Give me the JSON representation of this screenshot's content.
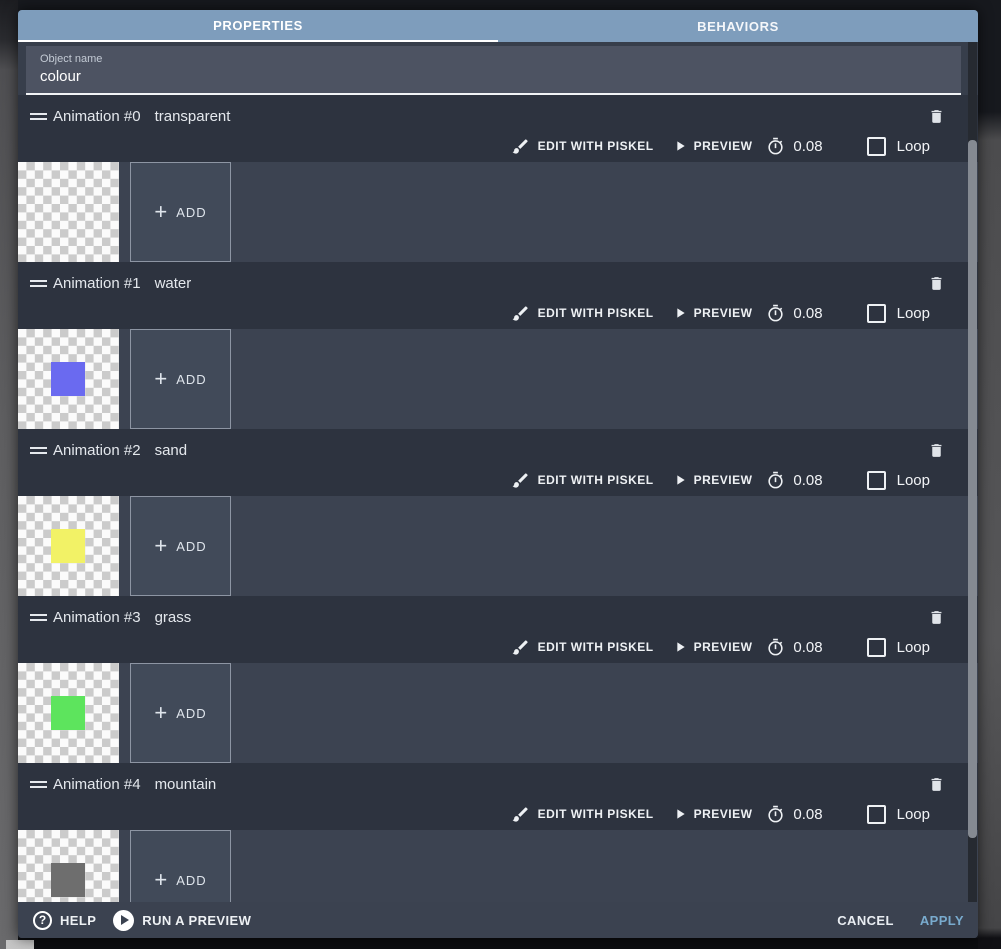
{
  "tabs": {
    "properties": "PROPERTIES",
    "behaviors": "BEHAVIORS"
  },
  "object_name_field": {
    "label": "Object name",
    "value": "colour"
  },
  "animations": [
    {
      "title": "Animation #0",
      "name": "transparent",
      "frame_color": null
    },
    {
      "title": "Animation #1",
      "name": "water",
      "frame_color": "#6a6af0"
    },
    {
      "title": "Animation #2",
      "name": "sand",
      "frame_color": "#f2f266"
    },
    {
      "title": "Animation #3",
      "name": "grass",
      "frame_color": "#5de45d"
    },
    {
      "title": "Animation #4",
      "name": "mountain",
      "frame_color": "#6e6e6e"
    }
  ],
  "controls": {
    "edit": "EDIT WITH PISKEL",
    "preview": "PREVIEW",
    "time_between_frames": "0.08",
    "loop": "Loop",
    "add_plus": "+",
    "add": "ADD"
  },
  "footer": {
    "help": "HELP",
    "run_preview": "RUN A PREVIEW",
    "cancel": "CANCEL",
    "apply": "APPLY"
  },
  "icons": {
    "help_glyph": "?"
  },
  "colors": {
    "tab_bar": "#7e9dbc",
    "header_bg": "#2d333f",
    "row_bg": "#3c4351",
    "panel_bg": "#4d5362",
    "apply_text": "#79abce",
    "scrollbar_thumb": "#858a92"
  }
}
